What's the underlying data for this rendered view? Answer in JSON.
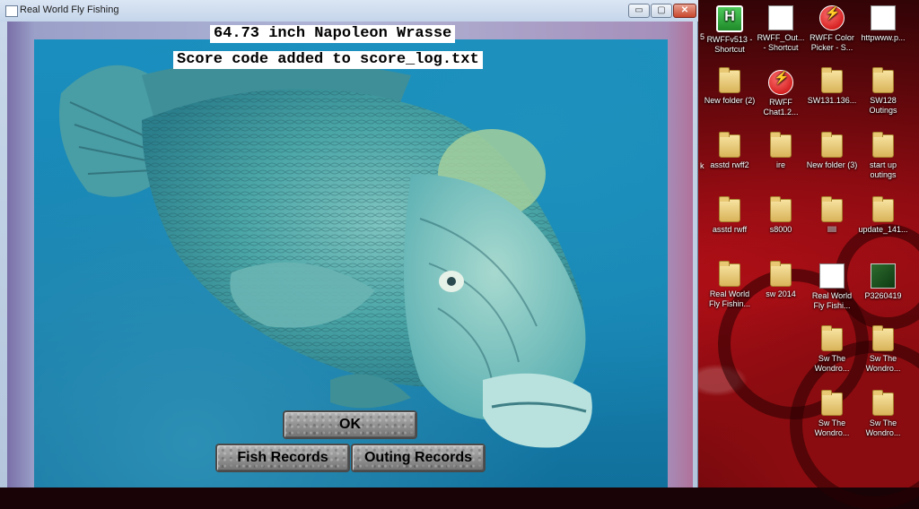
{
  "window": {
    "title": "Real World Fly Fishing",
    "controls": {
      "minimize": "▭",
      "maximize": "▢",
      "close": "✕"
    }
  },
  "game": {
    "fish_caught": "64.73 inch Napoleon Wrasse",
    "score_message": "Score code added to score_log.txt",
    "buttons": {
      "ok": "OK",
      "fish_records": "Fish Records",
      "outing_records": "Outing Records"
    }
  },
  "desktop": {
    "edge_labels": [
      "5",
      "k"
    ],
    "icons": [
      {
        "label": "RWFFv513 - Shortcut",
        "icon": "app-green-icon"
      },
      {
        "label": "RWFF_Out... - Shortcut",
        "icon": "app-doc-icon"
      },
      {
        "label": "RWFF Color Picker - S...",
        "icon": "app-bolt-icon"
      },
      {
        "label": "httpwww.p...",
        "icon": "web-doc-icon"
      },
      {
        "label": "New folder (2)",
        "icon": "folder-icon"
      },
      {
        "label": "RWFF Chat1.2...",
        "icon": "app-bolt-icon"
      },
      {
        "label": "SW131.136...",
        "icon": "folder-icon"
      },
      {
        "label": "SW128 Outings",
        "icon": "folder-icon"
      },
      {
        "label": "asstd rwff2",
        "icon": "folder-icon"
      },
      {
        "label": "ire",
        "icon": "folder-icon"
      },
      {
        "label": "New folder (3)",
        "icon": "folder-icon"
      },
      {
        "label": "start up outings",
        "icon": "folder-icon"
      },
      {
        "label": "asstd rwff",
        "icon": "folder-icon"
      },
      {
        "label": "s8000",
        "icon": "folder-icon"
      },
      {
        "label": "lllll",
        "icon": "folder-icon"
      },
      {
        "label": "update_141...",
        "icon": "folder-icon"
      },
      {
        "label": "Real World Fly Fishin...",
        "icon": "folder-icon"
      },
      {
        "label": "sw 2014",
        "icon": "folder-icon"
      },
      {
        "label": "Real World Fly Fishi...",
        "icon": "app-doc-icon"
      },
      {
        "label": "P3260419",
        "icon": "image-icon"
      },
      {
        "label": "Sw The Wondro...",
        "icon": "folder-icon"
      },
      {
        "label": "Sw The Wondro...",
        "icon": "folder-icon"
      },
      {
        "label": "Sw The Wondro...",
        "icon": "folder-icon"
      },
      {
        "label": "Sw The Wondro...",
        "icon": "folder-icon"
      }
    ]
  }
}
